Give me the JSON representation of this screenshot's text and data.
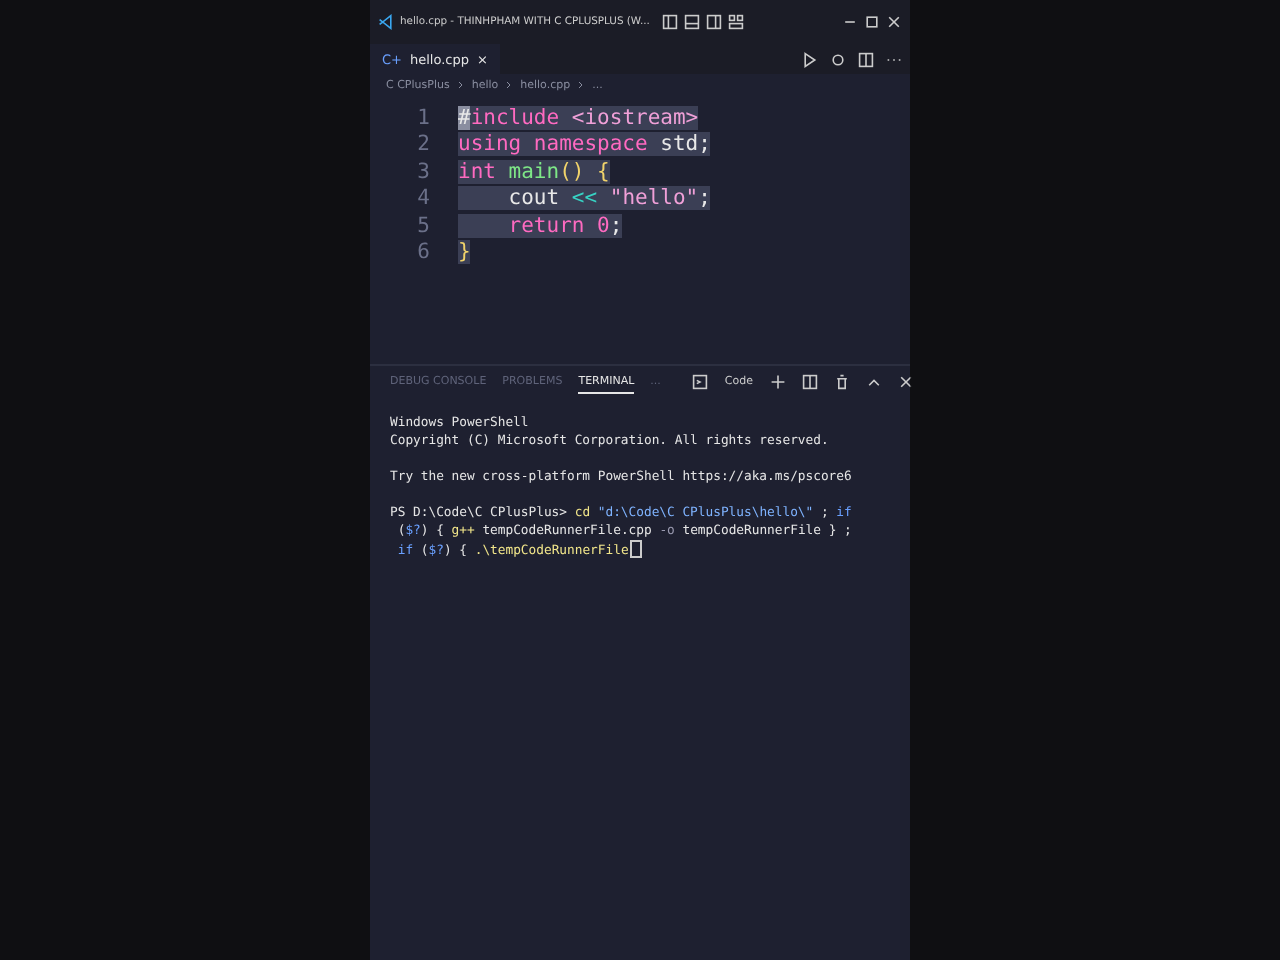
{
  "window": {
    "title": "hello.cpp - THINHPHAM WITH C CPLUSPLUS (W..."
  },
  "tabs": [
    {
      "label": "hello.cpp",
      "file_icon": "C+",
      "close": "×",
      "selected": true
    }
  ],
  "breadcrumb": [
    "C CPlusPlus",
    "hello",
    "hello.cpp",
    "..."
  ],
  "editor": {
    "lines": [
      {
        "number": "1",
        "tokens": [
          {
            "kind": "cursor",
            "text": "#"
          },
          {
            "kind": "keyword",
            "text": "include"
          },
          {
            "kind": "string",
            "text": " <iostream>"
          }
        ]
      },
      {
        "number": "2",
        "tokens": [
          {
            "kind": "keyword",
            "text": "using namespace"
          },
          {
            "kind": "plain",
            "text": " std;"
          }
        ]
      },
      {
        "number": "3",
        "tokens": [
          {
            "kind": "keyword",
            "text": "int"
          },
          {
            "kind": "function",
            "text": " main"
          },
          {
            "kind": "brace",
            "text": "() {"
          }
        ]
      },
      {
        "number": "4",
        "tokens": [
          {
            "kind": "plain",
            "text": "    cout"
          },
          {
            "kind": "operator",
            "text": " <<"
          },
          {
            "kind": "string",
            "text": " \"hello\""
          },
          {
            "kind": "plain",
            "text": ";"
          }
        ]
      },
      {
        "number": "5",
        "tokens": [
          {
            "kind": "keyword",
            "text": "    return"
          },
          {
            "kind": "number",
            "text": " 0"
          },
          {
            "kind": "plain",
            "text": ";"
          }
        ]
      },
      {
        "number": "6",
        "tokens": [
          {
            "kind": "brace",
            "text": "}"
          }
        ]
      }
    ]
  },
  "panel": {
    "tabs": [
      {
        "label": "DEBUG CONSOLE",
        "selected": false
      },
      {
        "label": "PROBLEMS",
        "selected": false
      },
      {
        "label": "TERMINAL",
        "selected": true
      },
      {
        "label": "...",
        "selected": false
      }
    ],
    "terminal_name": "Code",
    "cursor": true,
    "blocks": [
      [
        [
          {
            "kind": "plain",
            "text": "Windows PowerShell"
          }
        ],
        [
          {
            "kind": "plain",
            "text": "Copyright (C) Microsoft Corporation. All rights reserved."
          }
        ]
      ],
      [
        [
          {
            "kind": "plain",
            "text": "Try the new cross-platform PowerShell https://aka.ms/pscore6"
          }
        ]
      ],
      [
        [
          {
            "kind": "plain",
            "text": "PS D:\\Code\\C CPlusPlus> "
          },
          {
            "kind": "command",
            "text": "cd "
          },
          {
            "kind": "string",
            "text": "\"d:\\Code\\C CPlusPlus\\hello\\\""
          },
          {
            "kind": "plain",
            "text": " ; "
          },
          {
            "kind": "keyword",
            "text": "if"
          }
        ],
        [
          {
            "kind": "plain",
            "text": " ("
          },
          {
            "kind": "keyword",
            "text": "$?"
          },
          {
            "kind": "plain",
            "text": ") { "
          },
          {
            "kind": "command",
            "text": "g++"
          },
          {
            "kind": "plain",
            "text": " tempCodeRunnerFile.cpp "
          },
          {
            "kind": "param",
            "text": "-o"
          },
          {
            "kind": "plain",
            "text": " tempCodeRunnerFile } ;"
          }
        ],
        [
          {
            "kind": "keyword",
            "text": " if"
          },
          {
            "kind": "plain",
            "text": " ("
          },
          {
            "kind": "keyword",
            "text": "$?"
          },
          {
            "kind": "plain",
            "text": ") { "
          },
          {
            "kind": "command",
            "text": ".\\tempCodeRunnerFile"
          }
        ]
      ]
    ]
  }
}
